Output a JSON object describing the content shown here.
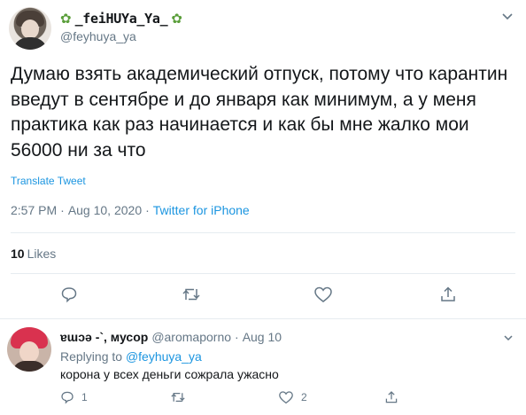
{
  "tweet": {
    "display_name": "_feiHUYa_Ya_",
    "handle": "@feyhuya_ya",
    "text": "Думаю взять академический отпуск, потому что карантин введут в сентябре и до января как минимум, а у меня практика как раз начинается и как бы мне жалко мои 56000 ни за что",
    "translate": "Translate Tweet",
    "time": "2:57 PM",
    "sep": "·",
    "date": "Aug 10, 2020",
    "source": "Twitter for iPhone",
    "likes_count": "10",
    "likes_label": "Likes",
    "icons": [
      "reply-icon",
      "retweet-icon",
      "like-icon",
      "share-icon",
      "leaf-icon",
      "caret-down-icon"
    ]
  },
  "reply": {
    "display_name": "ɐɯɔǝ -`, мусор",
    "handle": "@aromaporno",
    "sep": "·",
    "date": "Aug 10",
    "replying_prefix": "Replying to",
    "replying_handle": "@feyhuya_ya",
    "text": "корона у всех деньги сожрала ужасно",
    "reply_count": "1",
    "like_count": "2"
  }
}
